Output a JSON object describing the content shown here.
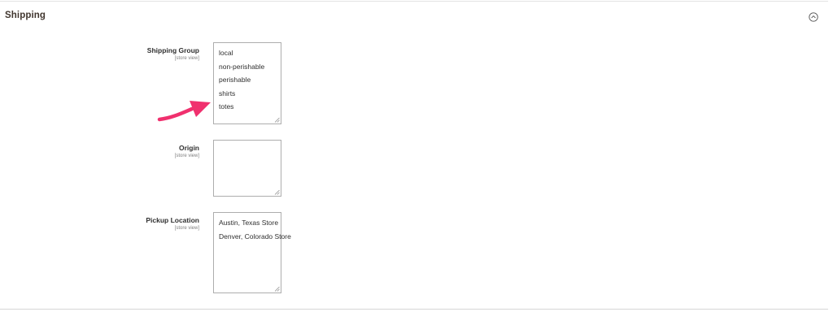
{
  "section": {
    "title": "Shipping",
    "collapse_icon": "chevron-up-circle-icon"
  },
  "fields": {
    "shipping_group": {
      "label": "Shipping Group",
      "scope": "[store view]",
      "options": [
        "local",
        "non-perishable",
        "perishable",
        "shirts",
        "totes"
      ]
    },
    "origin": {
      "label": "Origin",
      "scope": "[store view]",
      "options": []
    },
    "pickup_location": {
      "label": "Pickup Location",
      "scope": "[store view]",
      "options": [
        "Austin, Texas Store",
        "Denver, Colorado Store"
      ]
    }
  },
  "annotation": {
    "icon": "arrow-icon",
    "color": "#f0306e",
    "points_to": "totes"
  },
  "colors": {
    "border": "#adadad",
    "text": "#303030",
    "scope_text": "#808080"
  }
}
